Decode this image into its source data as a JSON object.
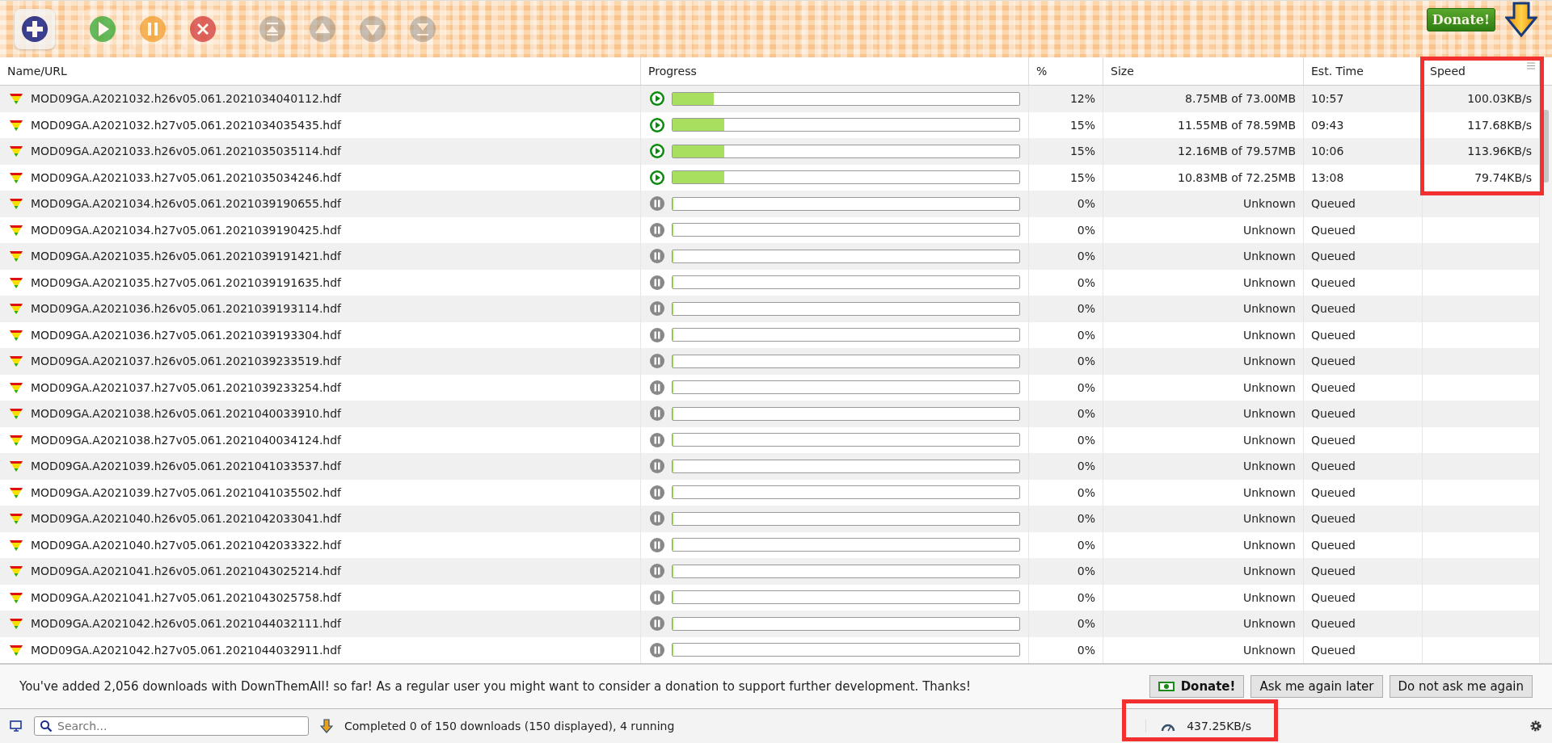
{
  "toolbar": {
    "buttons": [
      {
        "kind": "add",
        "disabled": false
      },
      {
        "kind": "resume",
        "disabled": false
      },
      {
        "kind": "pause",
        "disabled": false
      },
      {
        "kind": "cancel",
        "disabled": false
      },
      {
        "kind": "top",
        "disabled": true
      },
      {
        "kind": "up",
        "disabled": true
      },
      {
        "kind": "down",
        "disabled": true
      },
      {
        "kind": "bottom",
        "disabled": true
      }
    ],
    "donate": "Donate!"
  },
  "table": {
    "columns": [
      "Name/URL",
      "Progress",
      "%",
      "Size",
      "Est. Time",
      "Speed"
    ],
    "rows": [
      {
        "name": "MOD09GA.A2021032.h26v05.061.2021034040112.hdf",
        "kind": "running",
        "level": 0.12,
        "percent": "12%",
        "size": "8.75MB of 73.00MB",
        "time": "10:57",
        "speed": "100.03KB/s"
      },
      {
        "name": "MOD09GA.A2021032.h27v05.061.2021034035435.hdf",
        "kind": "running",
        "level": 0.15,
        "percent": "15%",
        "size": "11.55MB of 78.59MB",
        "time": "09:43",
        "speed": "117.68KB/s"
      },
      {
        "name": "MOD09GA.A2021033.h26v05.061.2021035035114.hdf",
        "kind": "running",
        "level": 0.15,
        "percent": "15%",
        "size": "12.16MB of 79.57MB",
        "time": "10:06",
        "speed": "113.96KB/s"
      },
      {
        "name": "MOD09GA.A2021033.h27v05.061.2021035034246.hdf",
        "kind": "running",
        "level": 0.15,
        "percent": "15%",
        "size": "10.83MB of 72.25MB",
        "time": "13:08",
        "speed": "79.74KB/s"
      },
      {
        "name": "MOD09GA.A2021034.h26v05.061.2021039190655.hdf",
        "kind": "queued",
        "level": 0,
        "percent": "0%",
        "size": "Unknown",
        "time": "Queued"
      },
      {
        "name": "MOD09GA.A2021034.h27v05.061.2021039190425.hdf",
        "kind": "queued",
        "level": 0,
        "percent": "0%",
        "size": "Unknown",
        "time": "Queued"
      },
      {
        "name": "MOD09GA.A2021035.h26v05.061.2021039191421.hdf",
        "kind": "queued",
        "level": 0,
        "percent": "0%",
        "size": "Unknown",
        "time": "Queued"
      },
      {
        "name": "MOD09GA.A2021035.h27v05.061.2021039191635.hdf",
        "kind": "queued",
        "level": 0,
        "percent": "0%",
        "size": "Unknown",
        "time": "Queued"
      },
      {
        "name": "MOD09GA.A2021036.h26v05.061.2021039193114.hdf",
        "kind": "queued",
        "level": 0,
        "percent": "0%",
        "size": "Unknown",
        "time": "Queued"
      },
      {
        "name": "MOD09GA.A2021036.h27v05.061.2021039193304.hdf",
        "kind": "queued",
        "level": 0,
        "percent": "0%",
        "size": "Unknown",
        "time": "Queued"
      },
      {
        "name": "MOD09GA.A2021037.h26v05.061.2021039233519.hdf",
        "kind": "queued",
        "level": 0,
        "percent": "0%",
        "size": "Unknown",
        "time": "Queued"
      },
      {
        "name": "MOD09GA.A2021037.h27v05.061.2021039233254.hdf",
        "kind": "queued",
        "level": 0,
        "percent": "0%",
        "size": "Unknown",
        "time": "Queued"
      },
      {
        "name": "MOD09GA.A2021038.h26v05.061.2021040033910.hdf",
        "kind": "queued",
        "level": 0,
        "percent": "0%",
        "size": "Unknown",
        "time": "Queued"
      },
      {
        "name": "MOD09GA.A2021038.h27v05.061.2021040034124.hdf",
        "kind": "queued",
        "level": 0,
        "percent": "0%",
        "size": "Unknown",
        "time": "Queued"
      },
      {
        "name": "MOD09GA.A2021039.h26v05.061.2021041033537.hdf",
        "kind": "queued",
        "level": 0,
        "percent": "0%",
        "size": "Unknown",
        "time": "Queued"
      },
      {
        "name": "MOD09GA.A2021039.h27v05.061.2021041035502.hdf",
        "kind": "queued",
        "level": 0,
        "percent": "0%",
        "size": "Unknown",
        "time": "Queued"
      },
      {
        "name": "MOD09GA.A2021040.h26v05.061.2021042033041.hdf",
        "kind": "queued",
        "level": 0,
        "percent": "0%",
        "size": "Unknown",
        "time": "Queued"
      },
      {
        "name": "MOD09GA.A2021040.h27v05.061.2021042033322.hdf",
        "kind": "queued",
        "level": 0,
        "percent": "0%",
        "size": "Unknown",
        "time": "Queued"
      },
      {
        "name": "MOD09GA.A2021041.h26v05.061.2021043025214.hdf",
        "kind": "queued",
        "level": 0,
        "percent": "0%",
        "size": "Unknown",
        "time": "Queued"
      },
      {
        "name": "MOD09GA.A2021041.h27v05.061.2021043025758.hdf",
        "kind": "queued",
        "level": 0,
        "percent": "0%",
        "size": "Unknown",
        "time": "Queued"
      },
      {
        "name": "MOD09GA.A2021042.h26v05.061.2021044032111.hdf",
        "kind": "queued",
        "level": 0,
        "percent": "0%",
        "size": "Unknown",
        "time": "Queued"
      },
      {
        "name": "MOD09GA.A2021042.h27v05.061.2021044032911.hdf",
        "kind": "queued",
        "level": 0,
        "percent": "0%",
        "size": "Unknown",
        "time": "Queued"
      }
    ]
  },
  "notification": {
    "message": "You've added 2,056 downloads with DownThemAll! so far! As a regular user you might want to consider a donation to support further development. Thanks!",
    "buttons": [
      {
        "kind": "donate",
        "label": "Donate!"
      },
      {
        "kind": "plain",
        "label": "Ask me again later"
      },
      {
        "kind": "plain",
        "label": "Do not ask me again"
      }
    ]
  },
  "status_bar": {
    "search_placeholder": "Search...",
    "status": "Completed 0 of 150 downloads (150 displayed), 4 running",
    "speed": "437.25KB/s"
  }
}
